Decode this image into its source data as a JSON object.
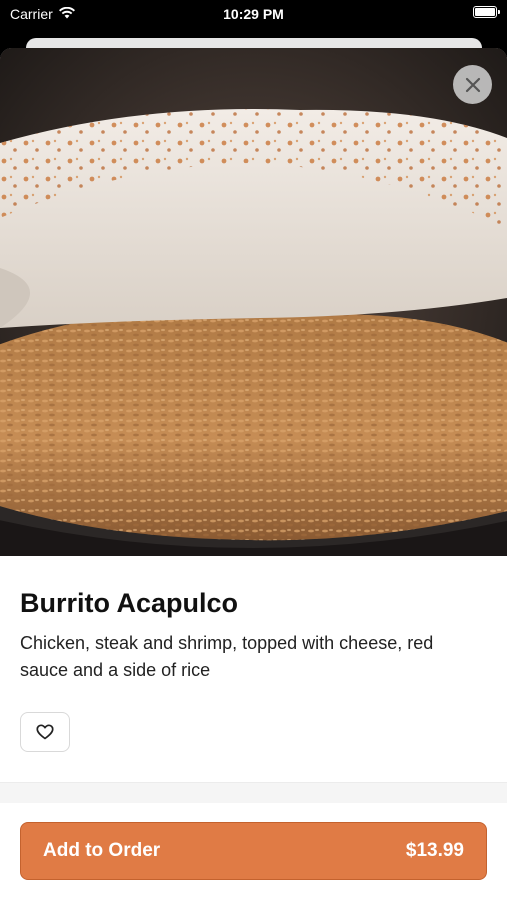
{
  "status_bar": {
    "carrier": "Carrier",
    "time": "10:29 PM",
    "icons": [
      "wifi-icon",
      "battery-icon"
    ]
  },
  "item": {
    "name": "Burrito Acapulco",
    "description": "Chicken, steak and shrimp, topped with cheese, red sauce and a side of rice",
    "image_alt": "burrito-with-rice-photo"
  },
  "actions": {
    "close_icon": "close-icon",
    "favorite_icon": "heart-icon",
    "add_label": "Add to Order",
    "price": "$13.99"
  },
  "colors": {
    "accent": "#e07b45",
    "accent_border": "#c4622e",
    "text": "#111111",
    "close_bg": "#d2d2d2"
  }
}
